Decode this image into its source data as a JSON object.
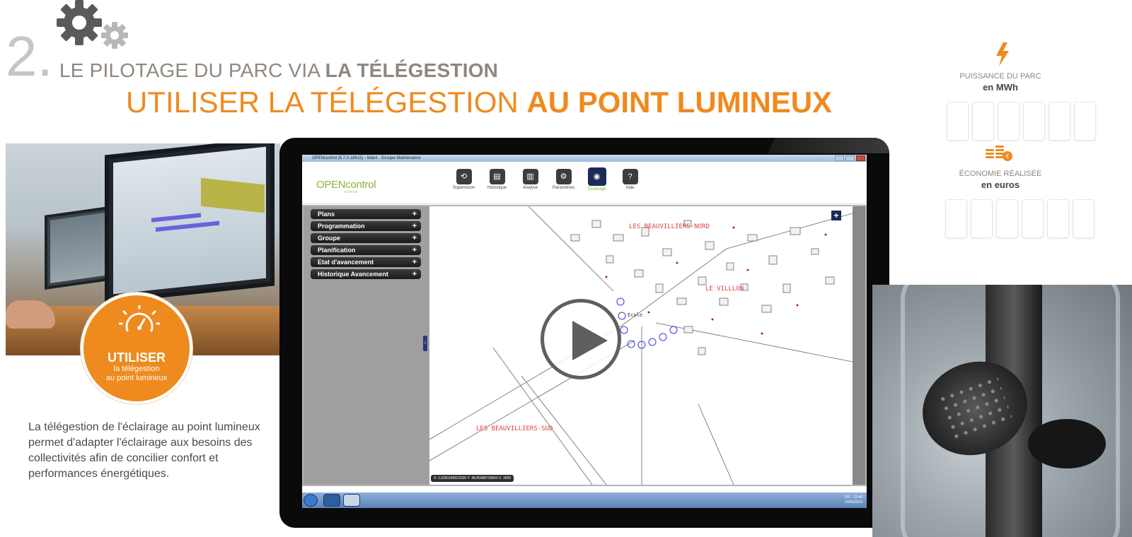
{
  "header": {
    "section_number": "2.",
    "section_title_normal": "LE PILOTAGE DU PARC VIA ",
    "section_title_bold": "LA TÉLÉGESTION",
    "main_title_normal": "UTILISER LA TÉLÉGESTION ",
    "main_title_bold": "AU POINT LUMINEUX",
    "accent_color": "#ef8a1f",
    "gray_color": "#8f8780",
    "icon": "gears-icon"
  },
  "badge": {
    "icon": "gauge-icon",
    "title": "UTILISER",
    "line1": "la télégestion",
    "line2": "au point lumineux"
  },
  "description": "La télégestion de l'éclairage au point lumineux permet d'adapter l'éclairage aux besoins des collectivités afin de concilier confort et performances énergétiques.",
  "app": {
    "window_title": "OPENcontrol (6.7.0.18615) - Maint - Groupe Maintenance",
    "logo": "OPENcontrol",
    "logo_sub": "citeos",
    "toolbar": [
      {
        "label": "Supervision",
        "icon": "supervision-icon",
        "glyph": "⟲"
      },
      {
        "label": "Historique",
        "icon": "history-icon",
        "glyph": "▤"
      },
      {
        "label": "Analyse",
        "icon": "analysis-icon",
        "glyph": "▥"
      },
      {
        "label": "Paramètres",
        "icon": "settings-icon",
        "glyph": "⚙"
      },
      {
        "label": "Éclairage",
        "icon": "bulb-icon",
        "glyph": "◉"
      },
      {
        "label": "Aide",
        "icon": "help-icon",
        "glyph": "?"
      }
    ],
    "sidebar": [
      {
        "label": "Plans"
      },
      {
        "label": "Programmation"
      },
      {
        "label": "Groupe"
      },
      {
        "label": "Planification"
      },
      {
        "label": "Etat d'avancement"
      },
      {
        "label": "Historique Avancement"
      }
    ],
    "map": {
      "labels": [
        "LES BEAUVILLIERS-SUD",
        "LES BEAUVILLIERS-NORD",
        "École",
        "LE VILLLON"
      ],
      "coords": "X: 2,5281180922536  Y: 48,85688730660  Z: 3000",
      "zoom_button": "+"
    },
    "taskbar": {
      "language": "FR",
      "time": "12:40",
      "date": "13/05/2014"
    }
  },
  "panel": {
    "power_label": "PUISSANCE DU PARC",
    "power_unit": "en MWh",
    "power_icon": "bolt-icon",
    "savings_label": "ÉCONOMIE RÉALISÉE",
    "savings_unit": "en euros",
    "savings_icon": "coins-icon"
  }
}
